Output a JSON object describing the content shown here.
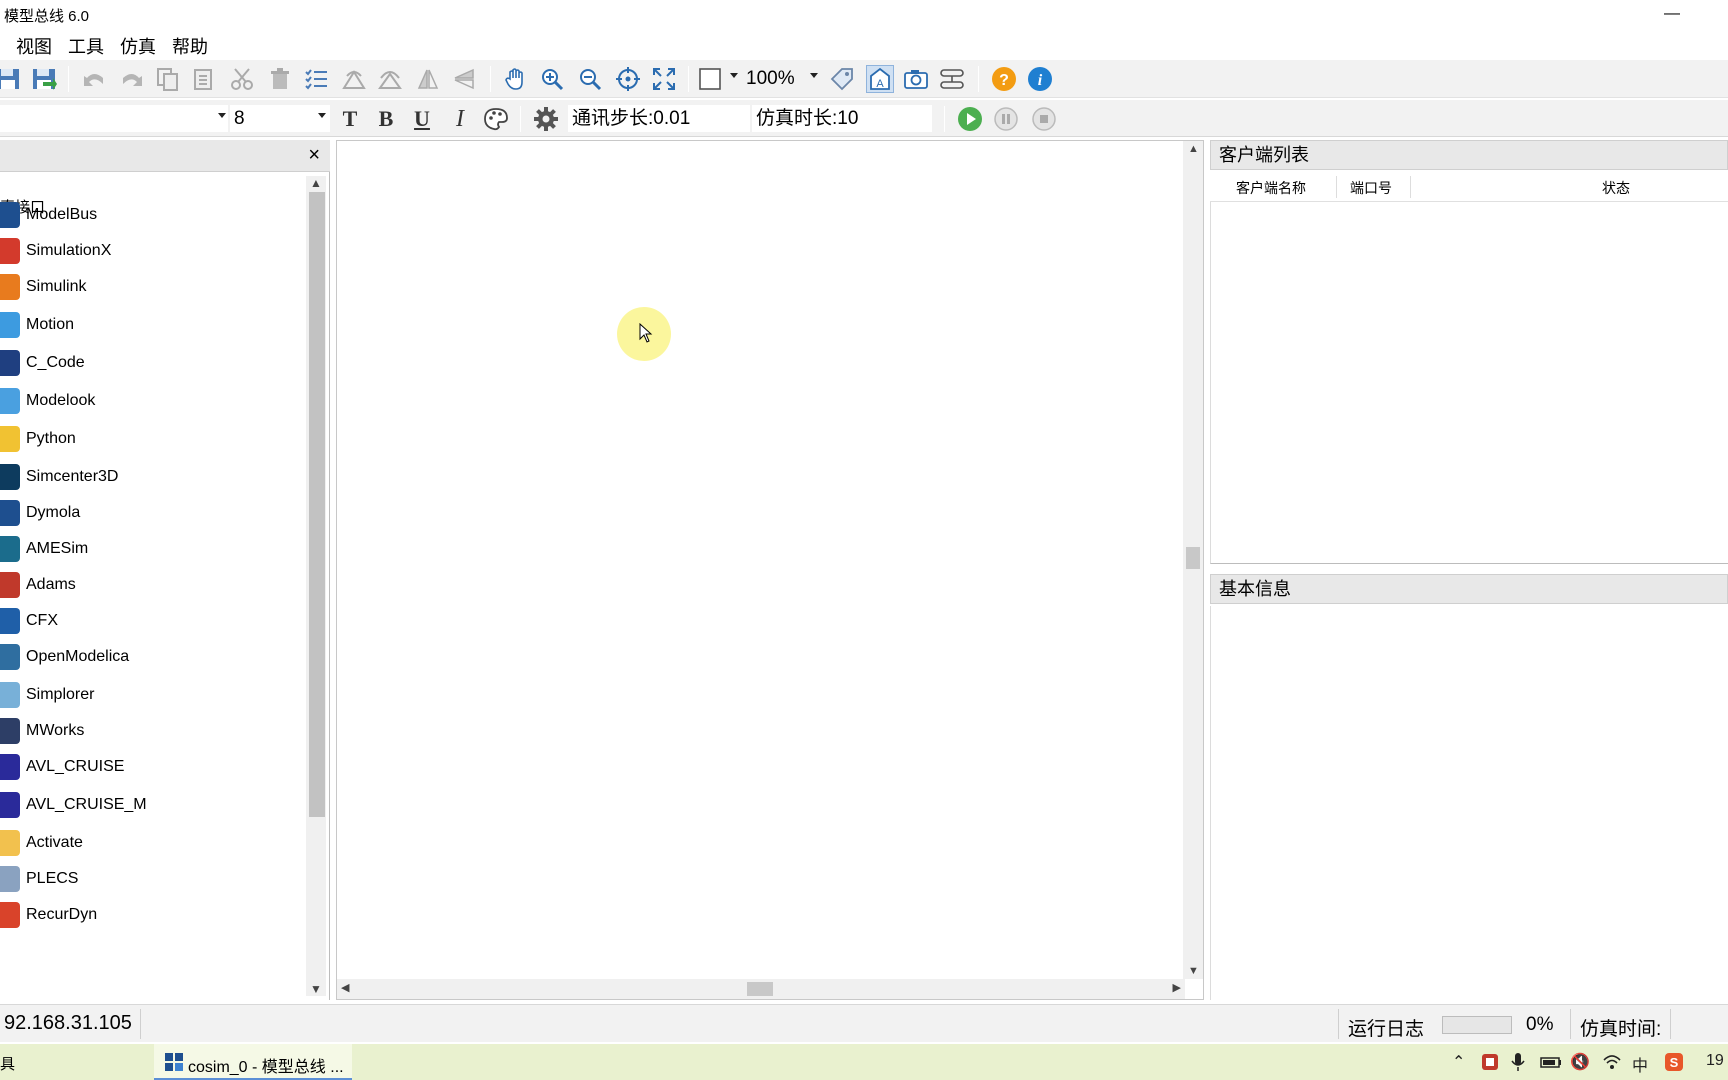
{
  "app": {
    "title": "模型总线 6.0",
    "minimize": "—"
  },
  "menu": [
    "视图",
    "工具",
    "仿真",
    "帮助"
  ],
  "toolbar": {
    "zoom_level": "100%",
    "font_size": "8",
    "comm_step_label": "通讯步长:0.01",
    "sim_duration_label": "仿真时长:10"
  },
  "left_panel": {
    "tree_root": "真接口",
    "items": [
      {
        "label": "ModelBus",
        "color": "#1e4f8f"
      },
      {
        "label": "SimulationX",
        "color": "#d33a2c"
      },
      {
        "label": "Simulink",
        "color": "#e87b1e"
      },
      {
        "label": "Motion",
        "color": "#3d9be0"
      },
      {
        "label": "C_Code",
        "color": "#1f3f80"
      },
      {
        "label": "Modelook",
        "color": "#4aa0e0"
      },
      {
        "label": "Python",
        "color": "#f1c232"
      },
      {
        "label": "Simcenter3D",
        "color": "#0d3b5e"
      },
      {
        "label": "Dymola",
        "color": "#1e4f8f"
      },
      {
        "label": "AMESim",
        "color": "#1b6c8c"
      },
      {
        "label": "Adams",
        "color": "#c0392b"
      },
      {
        "label": "CFX",
        "color": "#1f5fa8"
      },
      {
        "label": "OpenModelica",
        "color": "#2f6ea0"
      },
      {
        "label": "Simplorer",
        "color": "#78b0d8"
      },
      {
        "label": "MWorks",
        "color": "#2d3e66"
      },
      {
        "label": "AVL_CRUISE",
        "color": "#2a2a9a"
      },
      {
        "label": "AVL_CRUISE_M",
        "color": "#2a2a9a"
      },
      {
        "label": "Activate",
        "color": "#f2c14e"
      },
      {
        "label": "PLECS",
        "color": "#8aa2c0"
      },
      {
        "label": "RecurDyn",
        "color": "#d9432a"
      }
    ]
  },
  "right_panel": {
    "client_list_title": "客户端列表",
    "columns": [
      "客户端名称",
      "端口号",
      "状态"
    ],
    "basic_info_title": "基本信息"
  },
  "status_bar": {
    "ip": "92.168.31.105",
    "run_log": "运行日志",
    "progress_percent": "0%",
    "progress_value": 0,
    "sim_time_label": "仿真时间:"
  },
  "taskbar": {
    "left_label": "具",
    "task_label": "cosim_0 - 模型总线 ...",
    "ime": "中",
    "clock_partial": "19"
  }
}
